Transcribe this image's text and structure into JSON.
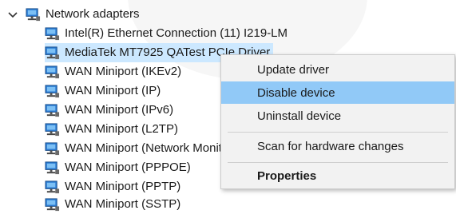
{
  "tree": {
    "category": {
      "label": "Network adapters",
      "icon": "network-adapter-icon",
      "expanded": true
    },
    "items": [
      {
        "label": "Intel(R) Ethernet Connection (11) I219-LM",
        "icon": "network-adapter-icon"
      },
      {
        "label": "MediaTek MT7925 QATest PCIe Driver",
        "icon": "network-adapter-icon",
        "selected": true
      },
      {
        "label": "WAN Miniport (IKEv2)",
        "icon": "network-adapter-icon"
      },
      {
        "label": "WAN Miniport (IP)",
        "icon": "network-adapter-icon"
      },
      {
        "label": "WAN Miniport (IPv6)",
        "icon": "network-adapter-icon"
      },
      {
        "label": "WAN Miniport (L2TP)",
        "icon": "network-adapter-icon"
      },
      {
        "label": "WAN Miniport (Network Monitor)",
        "icon": "network-adapter-icon"
      },
      {
        "label": "WAN Miniport (PPPOE)",
        "icon": "network-adapter-icon"
      },
      {
        "label": "WAN Miniport (PPTP)",
        "icon": "network-adapter-icon"
      },
      {
        "label": "WAN Miniport (SSTP)",
        "icon": "network-adapter-icon"
      }
    ]
  },
  "context_menu": {
    "items": [
      {
        "label": "Update driver"
      },
      {
        "label": "Disable device",
        "highlighted": true
      },
      {
        "label": "Uninstall device"
      },
      {
        "label": "Scan for hardware changes"
      },
      {
        "label": "Properties",
        "bold": true
      }
    ]
  },
  "colors": {
    "selection": "#cce8ff",
    "menu_highlight": "#91c9f7",
    "menu_background": "#f2f2f2"
  }
}
